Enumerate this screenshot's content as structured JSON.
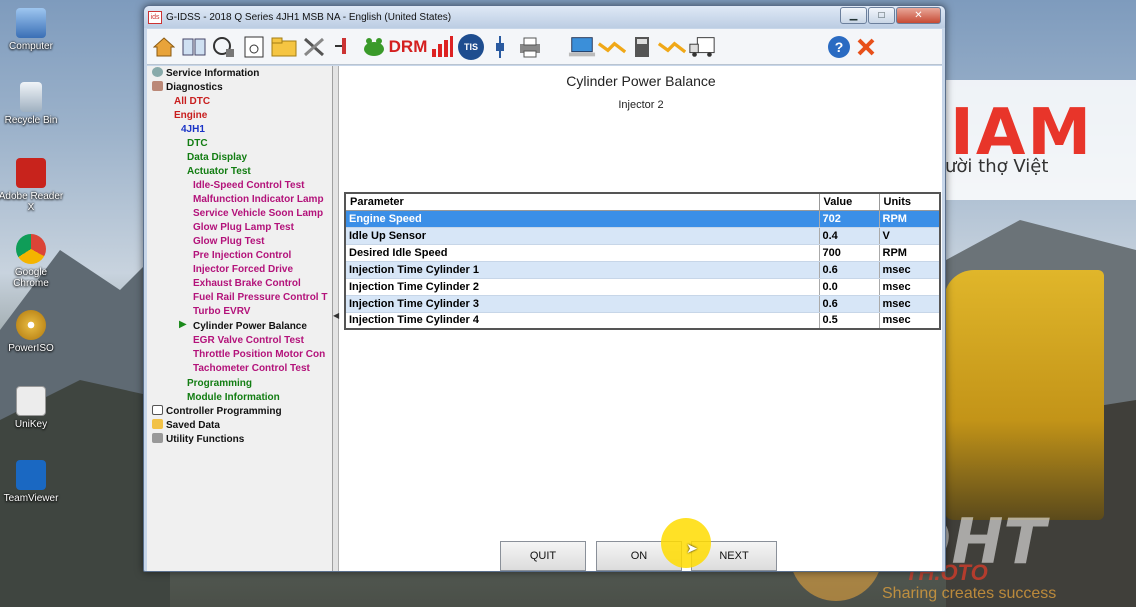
{
  "desktop": {
    "icons": [
      {
        "label": "Computer"
      },
      {
        "label": "Recycle Bin"
      },
      {
        "label": "Adobe Reader X"
      },
      {
        "label": "Google Chrome"
      },
      {
        "label": "PowerISO"
      },
      {
        "label": "UniKey"
      },
      {
        "label": "TeamViewer"
      }
    ],
    "brand_big": "IAM",
    "brand_sub": "ười thợ Việt",
    "watermark": "DHT",
    "watermark_sub": "TH.OTO",
    "watermark_tag": "Sharing creates success"
  },
  "window": {
    "app_icon": "ids",
    "title": "G-IDSS - 2018 Q Series 4JH1 MSB NA - English (United States)",
    "min": "▁",
    "max": "□",
    "close": "✕"
  },
  "toolbar": {
    "drm": "DRM",
    "tis": "TIS",
    "help": "?"
  },
  "tree": {
    "service_information": "Service Information",
    "diagnostics": "Diagnostics",
    "all_dtc": "All DTC",
    "engine": "Engine",
    "model": "4JH1",
    "dtc": "DTC",
    "data_display": "Data Display",
    "actuator_test": "Actuator Test",
    "tests": [
      "Idle-Speed Control Test",
      "Malfunction Indicator Lamp",
      "Service Vehicle Soon Lamp",
      "Glow Plug Lamp Test",
      "Glow Plug Test",
      "Pre Injection Control",
      "Injector Forced Drive",
      "Exhaust Brake Control",
      "Fuel Rail Pressure Control T",
      "Turbo EVRV",
      "Cylinder Power Balance",
      "EGR Valve Control Test",
      "Throttle Position Motor Con",
      "Tachometer Control Test"
    ],
    "programming": "Programming",
    "module_information": "Module Information",
    "controller_programming": "Controller Programming",
    "saved_data": "Saved Data",
    "utility_functions": "Utility Functions"
  },
  "main": {
    "title": "Cylinder Power Balance",
    "subtitle": "Injector 2",
    "columns": {
      "parameter": "Parameter",
      "value": "Value",
      "units": "Units"
    },
    "rows": [
      {
        "parameter": "Engine Speed",
        "value": "702",
        "units": "RPM"
      },
      {
        "parameter": "Idle Up Sensor",
        "value": "0.4",
        "units": "V"
      },
      {
        "parameter": "Desired Idle Speed",
        "value": "700",
        "units": "RPM"
      },
      {
        "parameter": "Injection Time Cylinder 1",
        "value": "0.6",
        "units": "msec"
      },
      {
        "parameter": "Injection Time Cylinder 2",
        "value": "0.0",
        "units": "msec"
      },
      {
        "parameter": "Injection Time Cylinder 3",
        "value": "0.6",
        "units": "msec"
      },
      {
        "parameter": "Injection Time Cylinder 4",
        "value": "0.5",
        "units": "msec"
      }
    ],
    "buttons": {
      "quit": "QUIT",
      "on": "ON",
      "next": "NEXT"
    }
  }
}
